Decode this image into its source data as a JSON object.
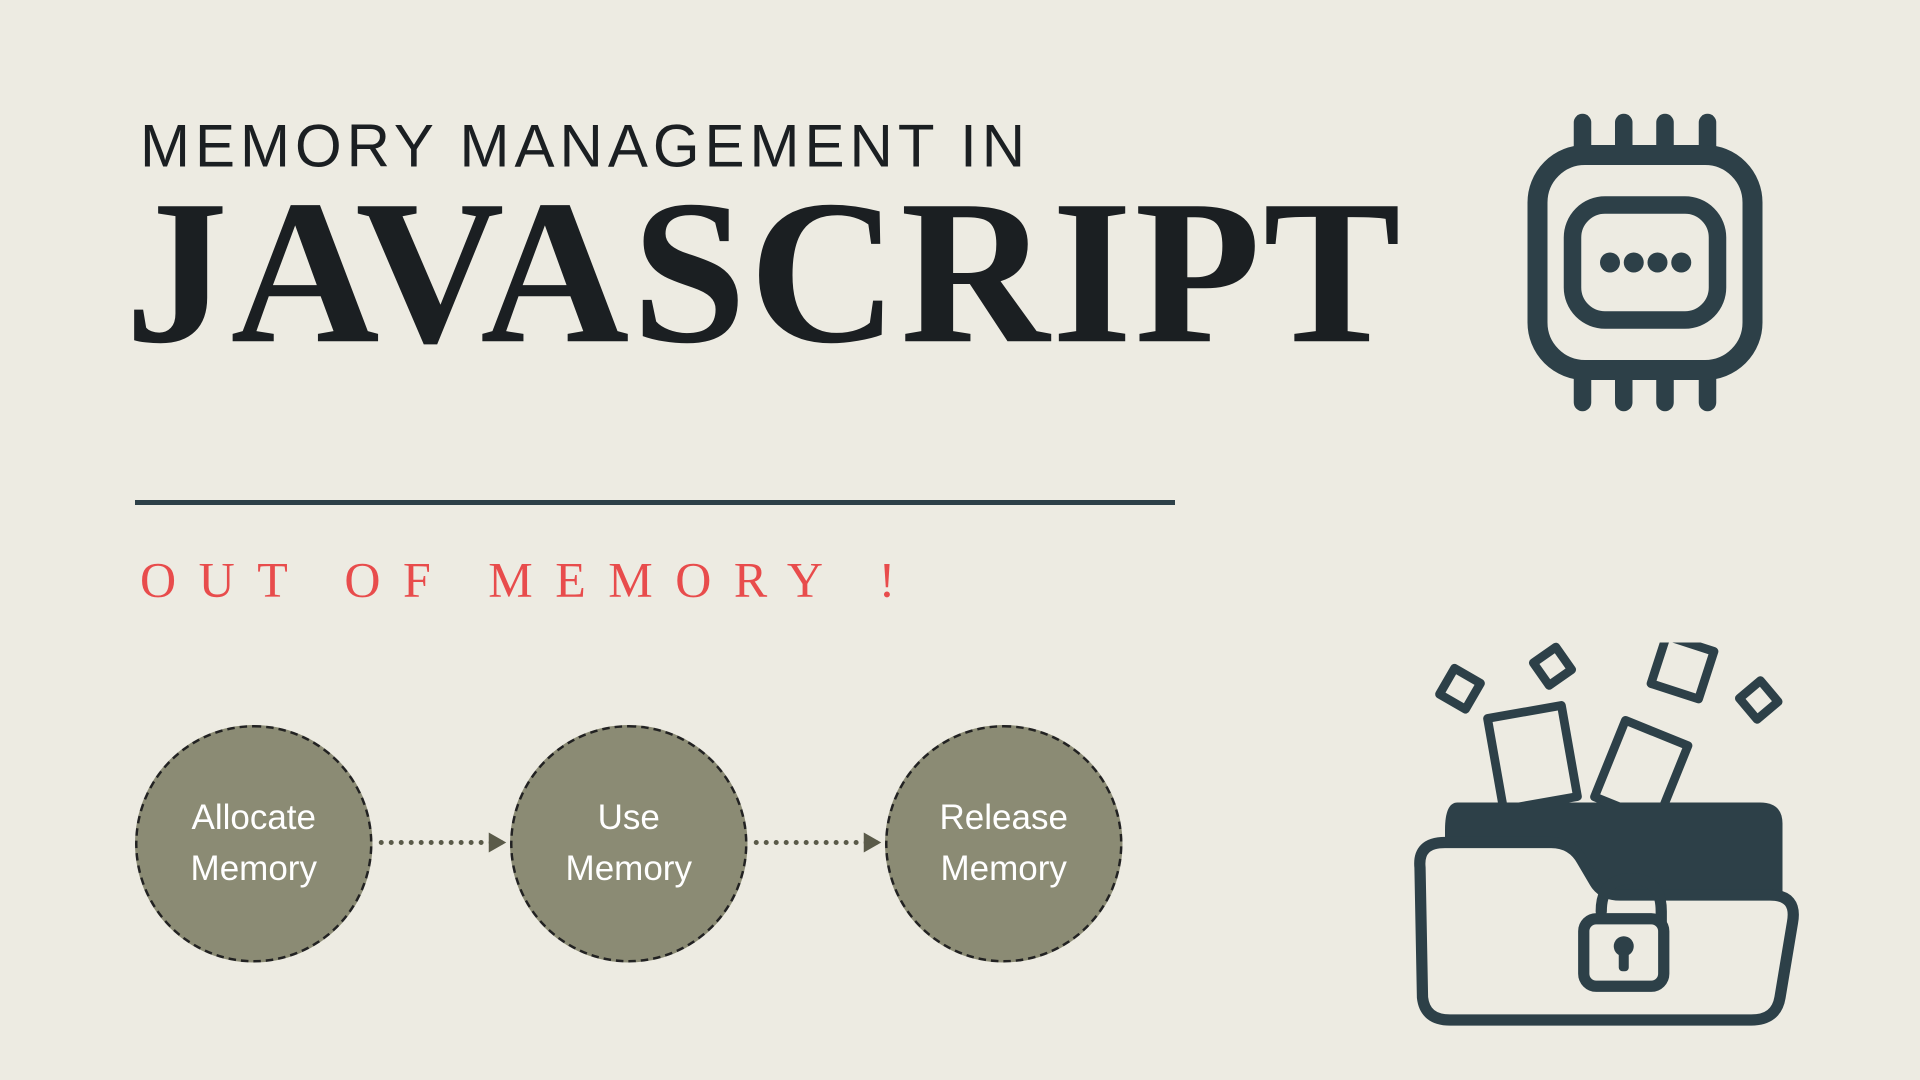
{
  "header": {
    "subtitle": "MEMORY MANAGEMENT IN",
    "title": "JAVASCRIPT"
  },
  "alert": "OUT OF MEMORY !",
  "flow": {
    "nodes": [
      {
        "line1": "Allocate",
        "line2": "Memory"
      },
      {
        "line1": "Use",
        "line2": "Memory"
      },
      {
        "line1": "Release",
        "line2": "Memory"
      }
    ]
  },
  "icons": {
    "chip": "memory-chip-icon",
    "folder": "unlocked-folder-icon"
  },
  "colors": {
    "background": "#EDEBE2",
    "ink": "#1B1F22",
    "teal": "#2D4048",
    "red": "#E84C4C",
    "olive": "#8B8B74"
  }
}
